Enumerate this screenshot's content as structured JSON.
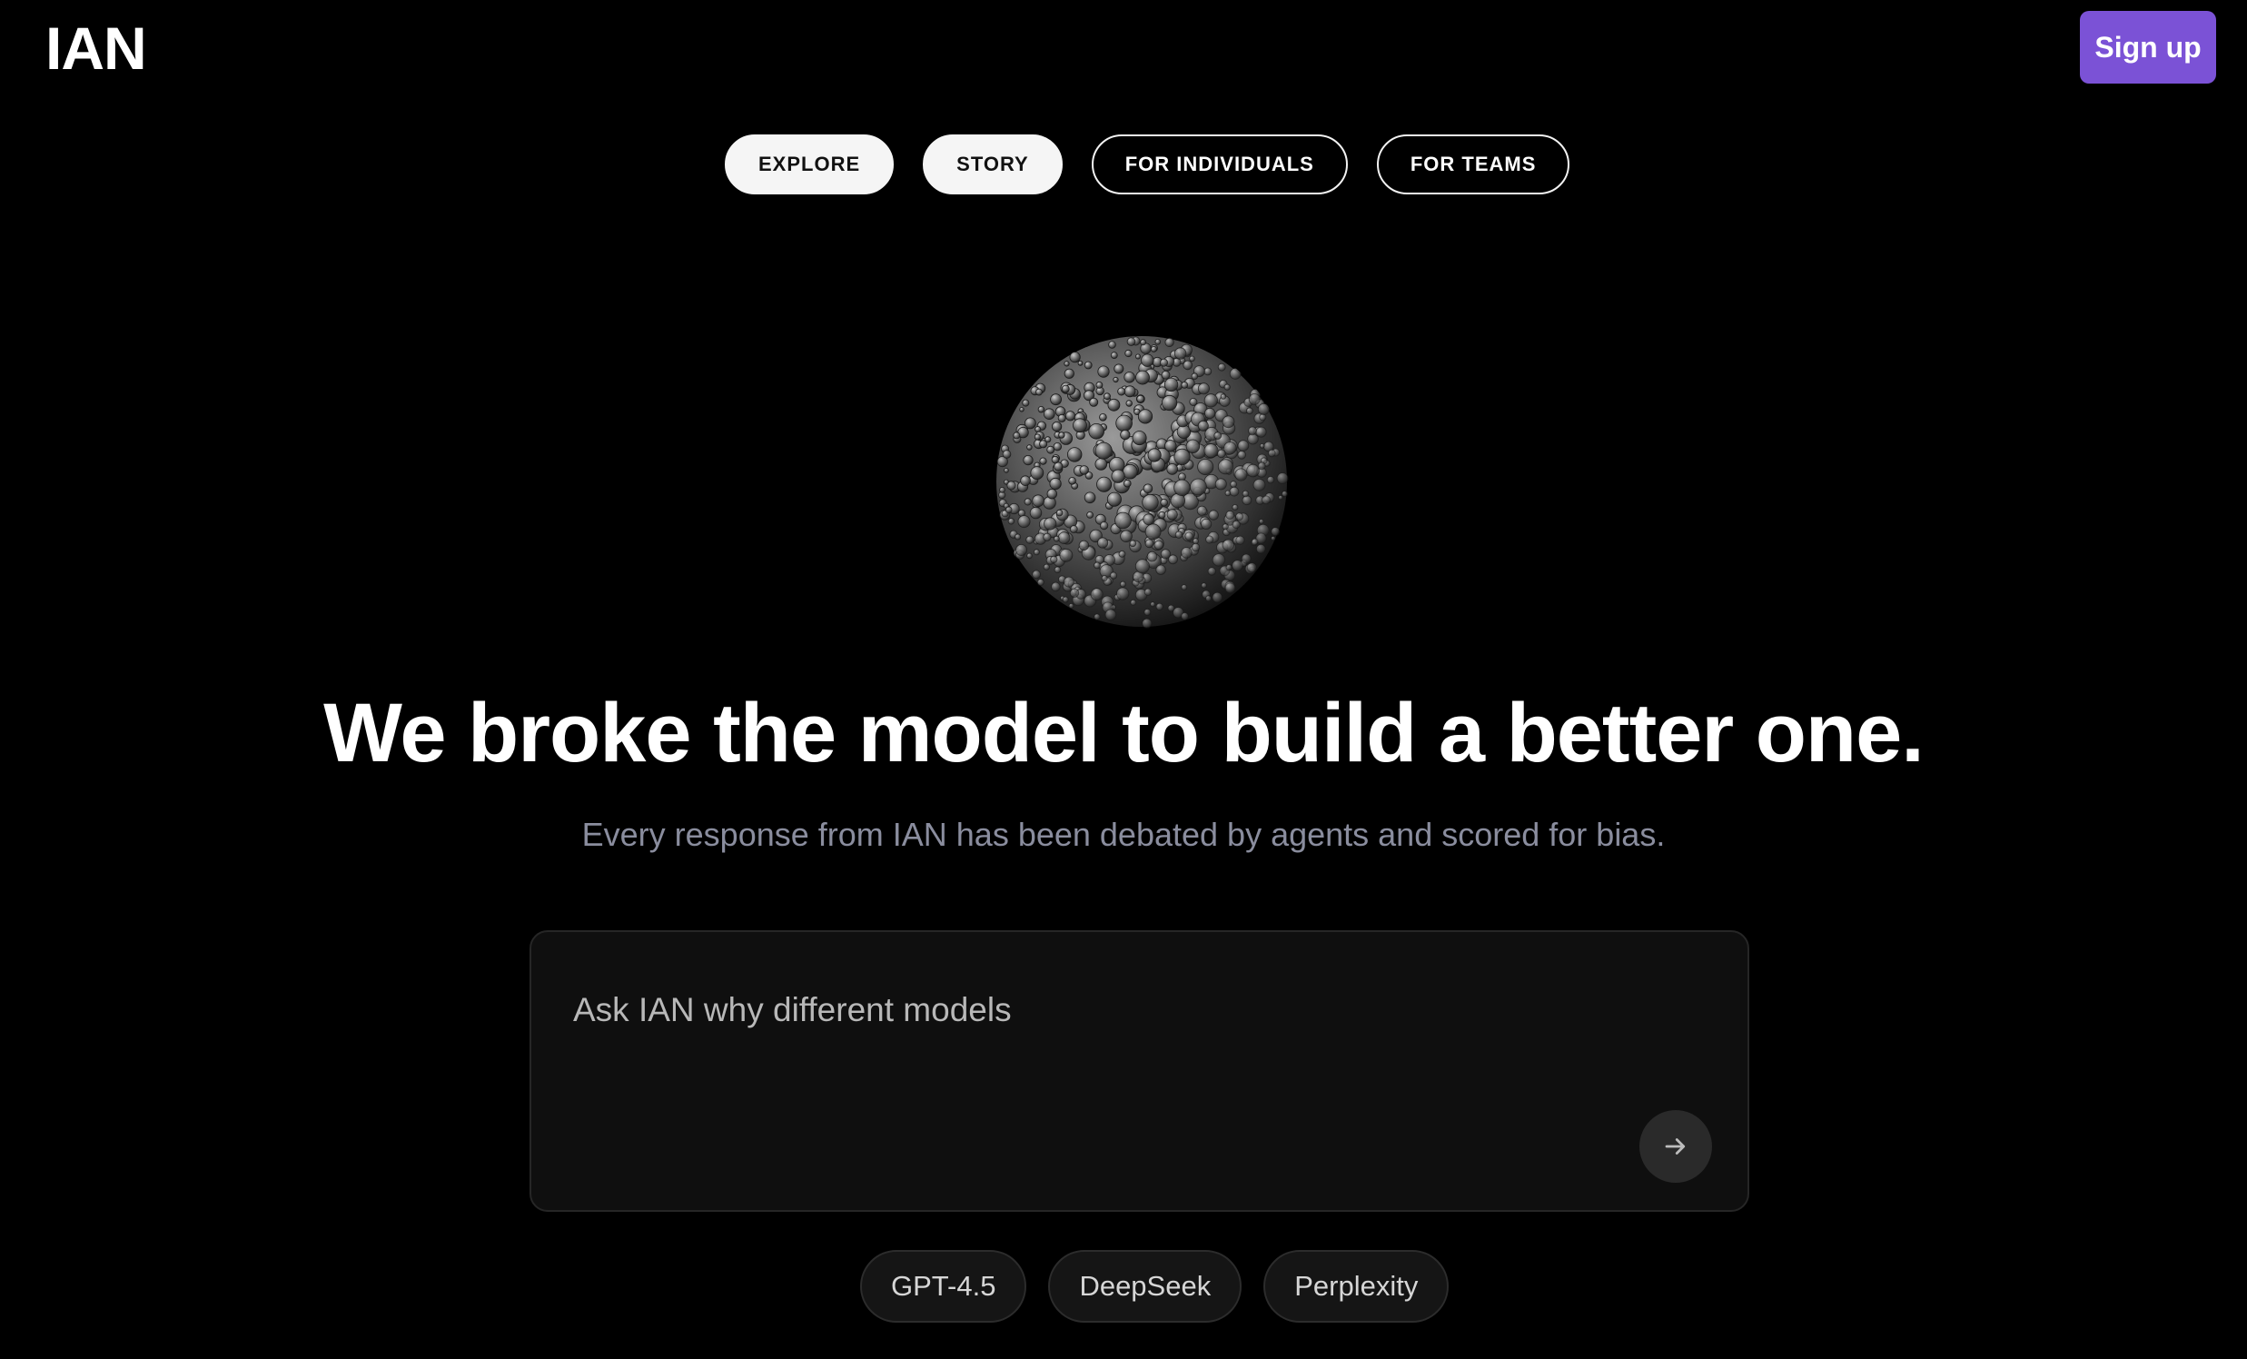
{
  "header": {
    "logo": "IAN",
    "signup_label": "Sign up"
  },
  "nav": {
    "items": [
      {
        "label": "EXPLORE",
        "style": "filled"
      },
      {
        "label": "STORY",
        "style": "filled"
      },
      {
        "label": "FOR INDIVIDUALS",
        "style": "outline"
      },
      {
        "label": "FOR TEAMS",
        "style": "outline"
      }
    ]
  },
  "hero": {
    "headline": "We broke the model to build a better one.",
    "subheadline": "Every response from IAN has been debated by agents and scored for bias."
  },
  "prompt": {
    "value": "Ask IAN why different models",
    "send_icon": "arrow-right-icon"
  },
  "models": {
    "chips": [
      "GPT-4.5",
      "DeepSeek",
      "Perplexity"
    ]
  },
  "colors": {
    "background": "#000000",
    "accent": "#7b52d6",
    "subtext": "#8a8d9e",
    "prompt_bg": "#0f0f0f"
  }
}
